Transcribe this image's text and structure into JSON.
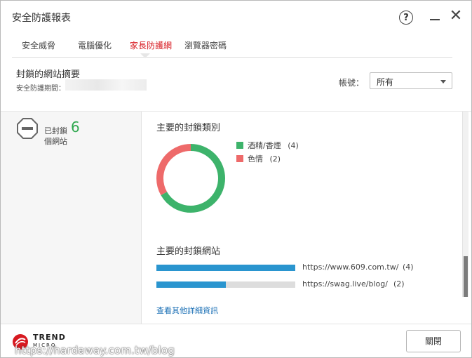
{
  "window": {
    "title": "安全防護報表",
    "help_label": "?",
    "close_label": "✕"
  },
  "tabs": [
    {
      "label": "安全威脅",
      "active": false
    },
    {
      "label": "電腦優化",
      "active": false
    },
    {
      "label": "家長防護網",
      "active": true
    },
    {
      "label": "瀏覽器密碼",
      "active": false
    }
  ],
  "summary": {
    "title": "封鎖的網站摘要",
    "period_label": "安全防護期間："
  },
  "account": {
    "label": "帳號：",
    "selected": "所有"
  },
  "blocked": {
    "prefix": "已封鎖",
    "count": "6",
    "suffix": "個網站",
    "icon": "blocked-sign-icon"
  },
  "categories": {
    "title": "主要的封鎖類別",
    "items": [
      {
        "label": "酒精/香煙",
        "count": "(4)",
        "value": 4,
        "color": "#3db36b"
      },
      {
        "label": "色情",
        "count": "(2)",
        "value": 2,
        "color": "#ee6a6a"
      }
    ]
  },
  "sites": {
    "title": "主要的封鎖網站",
    "items": [
      {
        "url": "https://www.609.com.tw/",
        "count": "(4)",
        "value": 4
      },
      {
        "url": "https://swag.live/blog/",
        "count": "(2)",
        "value": 2
      }
    ],
    "bar_color": "#2a95cf",
    "more_link": "查看其他詳細資訊"
  },
  "footer": {
    "brand_name": "TREND",
    "brand_sub": "MICRO",
    "close_button": "關閉",
    "watermark": "https://hardaway.com.tw/blog"
  }
}
